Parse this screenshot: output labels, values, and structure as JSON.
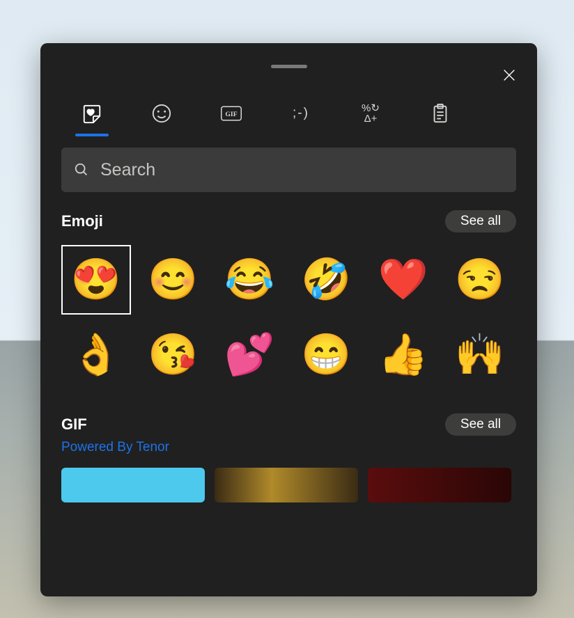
{
  "tabs": [
    {
      "name": "recent",
      "icon": "sticker-heart-icon"
    },
    {
      "name": "emoji",
      "icon": "smiley-icon"
    },
    {
      "name": "gif",
      "icon": "gif-icon",
      "label": "GIF"
    },
    {
      "name": "kaomoji",
      "icon": "kaomoji-icon",
      "label": ";-)"
    },
    {
      "name": "symbols",
      "icon": "symbols-icon",
      "label_top": "%↻",
      "label_bottom": "Δ+"
    },
    {
      "name": "clipboard",
      "icon": "clipboard-icon"
    }
  ],
  "search": {
    "placeholder": "Search"
  },
  "emoji_section": {
    "title": "Emoji",
    "see_all": "See all",
    "items": [
      {
        "name": "heart-eyes",
        "char": "😍",
        "selected": true
      },
      {
        "name": "blush",
        "char": "😊"
      },
      {
        "name": "joy",
        "char": "😂"
      },
      {
        "name": "rofl",
        "char": "🤣"
      },
      {
        "name": "red-heart",
        "char": "❤️"
      },
      {
        "name": "unamused",
        "char": "😒"
      },
      {
        "name": "ok-hand",
        "char": "👌"
      },
      {
        "name": "kissing-heart",
        "char": "😘"
      },
      {
        "name": "two-hearts",
        "char": "💕"
      },
      {
        "name": "grin",
        "char": "😁"
      },
      {
        "name": "thumbs-up",
        "char": "👍"
      },
      {
        "name": "raising-hands",
        "char": "🙌"
      }
    ]
  },
  "gif_section": {
    "title": "GIF",
    "see_all": "See all",
    "powered_by": "Powered By Tenor"
  }
}
